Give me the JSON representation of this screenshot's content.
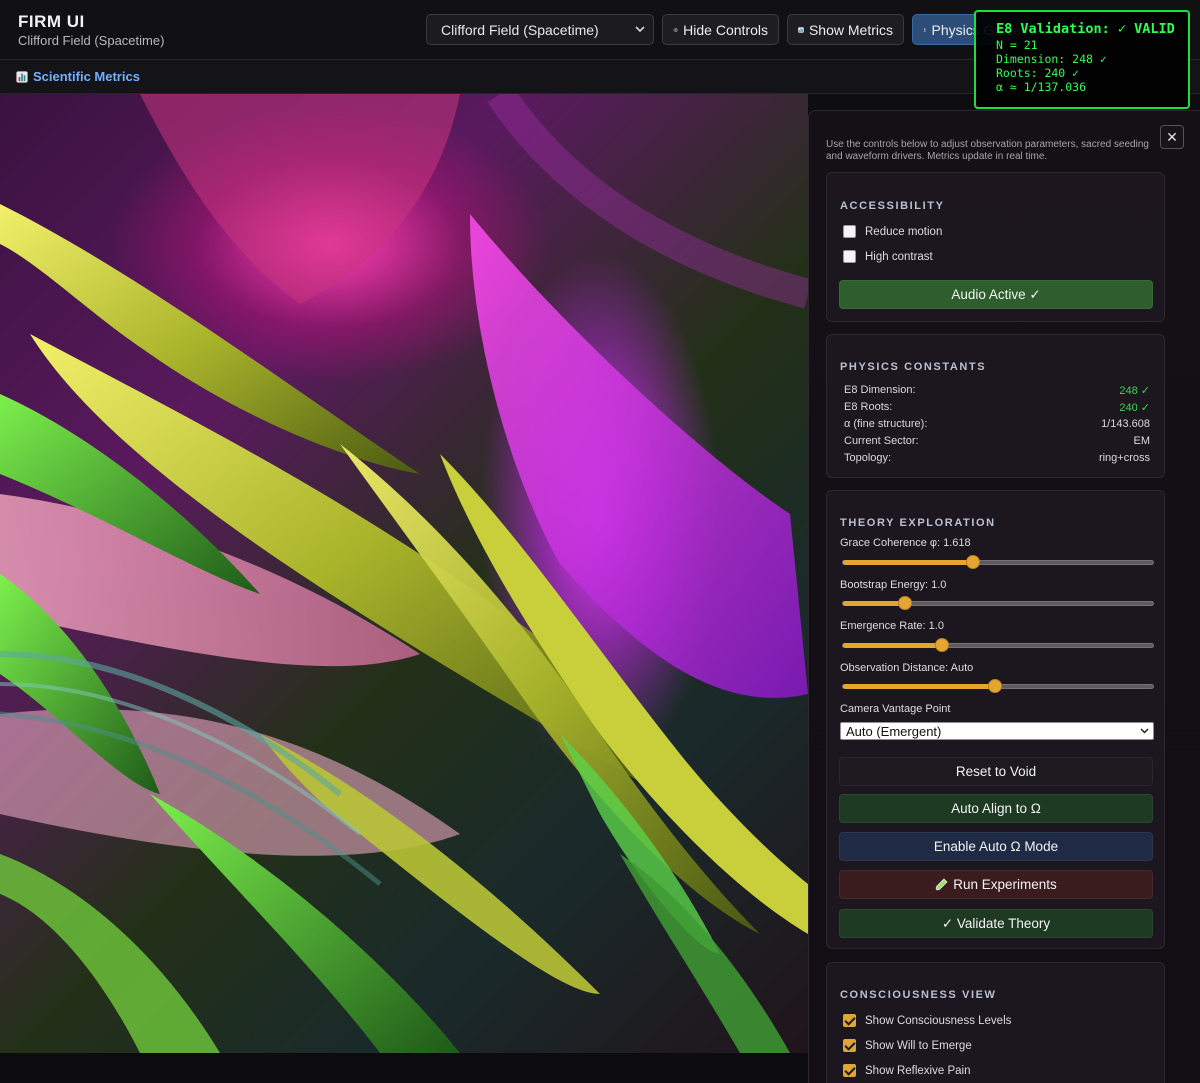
{
  "header": {
    "app_title": "FIRM UI",
    "app_subtitle": "Clifford Field (Spacetime)",
    "field_select_value": "Clifford Field (Spacetime)",
    "hide_controls_label": "Hide Controls",
    "show_metrics_label": "Show Metrics",
    "physics_label": "Physics Guide"
  },
  "subbar": {
    "metrics_label": "Scientific Metrics"
  },
  "e8_overlay": {
    "title": "E8 Validation: ✓ VALID",
    "lines": [
      "N = 21",
      "Dimension: 248 ✓",
      "Roots: 240 ✓",
      "α ≈ 1/137.036"
    ]
  },
  "panel": {
    "intro": "Use the controls below to adjust observation parameters, sacred seeding and waveform drivers. Metrics update in real time.",
    "close_symbol": "✕",
    "accessibility": {
      "title": "ACCESSIBILITY",
      "reduce_motion": "Reduce motion",
      "high_contrast": "High contrast",
      "audio_label": "Audio Active ✓"
    },
    "physics": {
      "title": "PHYSICS CONSTANTS",
      "rows": [
        {
          "label": "E8 Dimension:",
          "value": "248 ✓",
          "status": "ok"
        },
        {
          "label": "E8 Roots:",
          "value": "240 ✓",
          "status": "ok"
        },
        {
          "label": "α (fine structure):",
          "value": "1/143.608",
          "status": "plain"
        },
        {
          "label": "Current Sector:",
          "value": "EM",
          "status": "plain"
        },
        {
          "label": "Topology:",
          "value": "ring+cross",
          "status": "plain"
        }
      ]
    },
    "theory": {
      "title": "THEORY EXPLORATION",
      "sliders": [
        {
          "label": "Grace Coherence φ: 1.618",
          "level": 0.42
        },
        {
          "label": "Bootstrap Energy: 1.0",
          "level": 0.2
        },
        {
          "label": "Emergence Rate: 1.0",
          "level": 0.32
        },
        {
          "label": "Observation Distance: Auto",
          "level": 0.49
        }
      ],
      "vantage_label": "Camera Vantage Point",
      "vantage_value": "Auto (Emergent)",
      "reset_label": "Reset to Void",
      "align_label": "Auto Align to Ω",
      "auto_mode_label": "Enable Auto Ω Mode",
      "experiments_label": "Run Experiments",
      "validate_label": "✓ Validate Theory"
    },
    "consciousness": {
      "title": "CONSCIOUSNESS VIEW",
      "items": [
        "Show Consciousness Levels",
        "Show Will to Emerge",
        "Show Reflexive Pain"
      ]
    }
  },
  "colors": {
    "accent_orange": "#e6a52d",
    "validation_green": "#2bff4f",
    "link_blue": "#6fb0ff",
    "audio_green": "#2f5e2e",
    "button_green": "#1f3a22",
    "button_navy": "#1f2b45",
    "button_maroon": "#3a1c1e"
  },
  "icons": {
    "hide_controls": "gear-icon",
    "show_metrics": "bar-chart-icon",
    "physics": "microscope-icon",
    "experiments": "test-tube-icon"
  }
}
